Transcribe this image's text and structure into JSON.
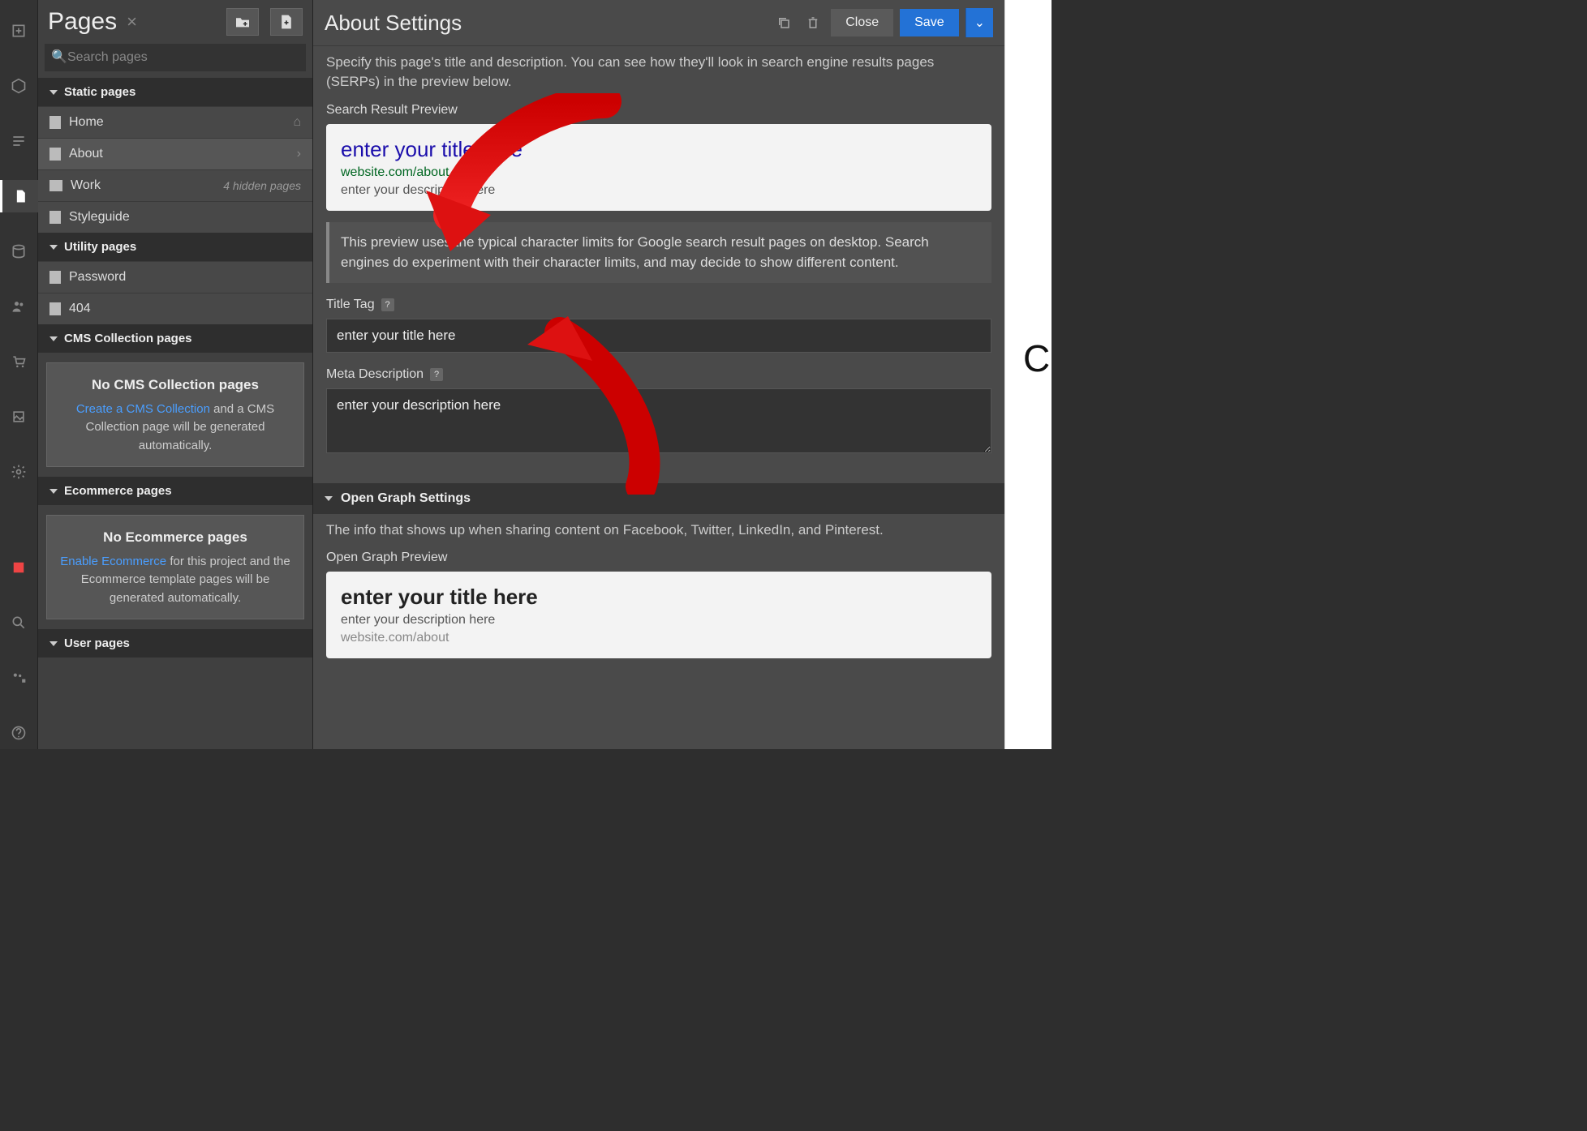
{
  "left_panel": {
    "title": "Pages",
    "search_placeholder": "Search pages",
    "groups": {
      "static": {
        "label": "Static pages",
        "items": [
          {
            "label": "Home"
          },
          {
            "label": "About"
          },
          {
            "label": "Work",
            "aside": "4 hidden pages"
          },
          {
            "label": "Styleguide"
          }
        ]
      },
      "utility": {
        "label": "Utility pages",
        "items": [
          {
            "label": "Password"
          },
          {
            "label": "404"
          }
        ]
      },
      "cms": {
        "label": "CMS Collection pages",
        "empty_title": "No CMS Collection pages",
        "link_text": "Create a CMS Collection",
        "text_rest": " and a CMS Collection page will be generated automatically."
      },
      "ecommerce": {
        "label": "Ecommerce pages",
        "empty_title": "No Ecommerce pages",
        "link_text": "Enable Ecommerce",
        "text_rest": " for this project and the Ecommerce template pages will be generated automatically."
      },
      "user": {
        "label": "User pages"
      }
    }
  },
  "settings": {
    "title": "About Settings",
    "close_label": "Close",
    "save_label": "Save",
    "seo": {
      "desc": "Specify this page's title and description. You can see how they'll look in search engine results pages (SERPs) in the preview below.",
      "preview_label": "Search Result Preview",
      "serp_title": "enter your title here",
      "serp_url": "website.com/about",
      "serp_desc": "enter your description here",
      "note": "This preview uses the typical character limits for Google search result pages on desktop. Search engines do experiment with their character limits, and may decide to show different content.",
      "title_tag_label": "Title Tag",
      "title_tag_value": "enter your title here",
      "meta_label": "Meta Description",
      "meta_value": "enter your description here"
    },
    "og": {
      "header": "Open Graph Settings",
      "desc": "The info that shows up when sharing content on Facebook, Twitter, LinkedIn, and Pinterest.",
      "preview_label": "Open Graph Preview",
      "title": "enter your title here",
      "sub": "enter your description here",
      "url": "website.com/about"
    }
  },
  "right_glyph": "C"
}
